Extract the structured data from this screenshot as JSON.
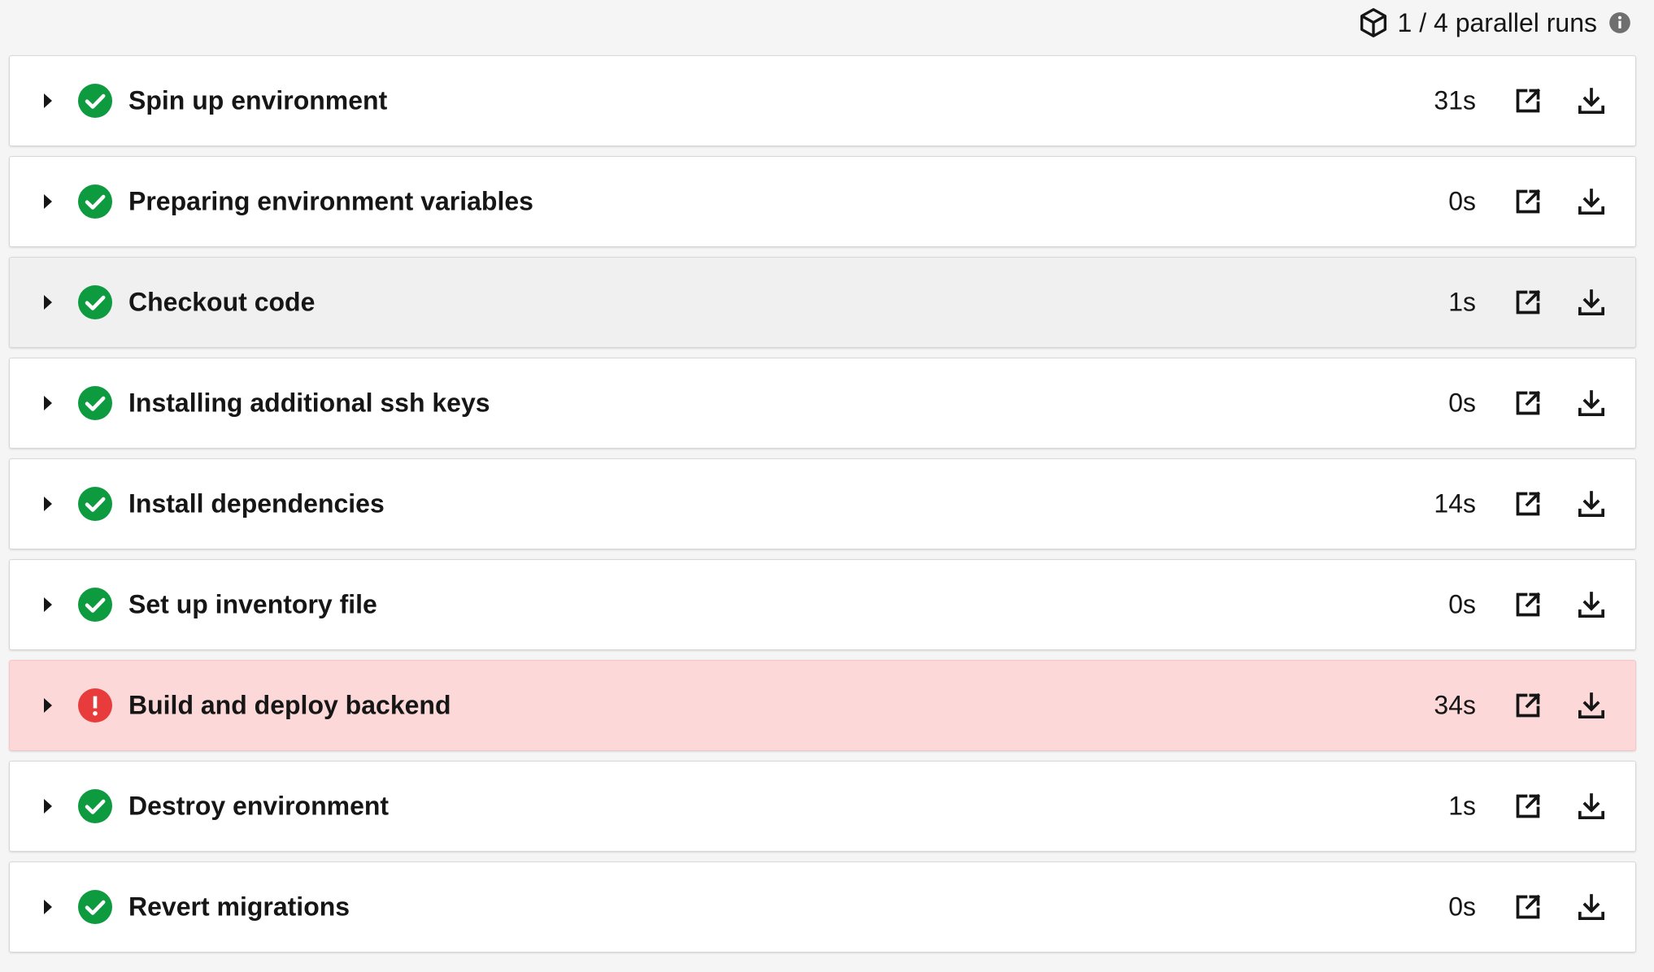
{
  "header": {
    "parallel_runs": "1 / 4 parallel runs"
  },
  "colors": {
    "success": "#0e9b3f",
    "failed": "#e83c3c",
    "failed_row_bg": "#fcd8d8",
    "hover_row_bg": "#f0f0f0"
  },
  "steps": [
    {
      "name": "Spin up environment",
      "duration": "31s",
      "status": "success"
    },
    {
      "name": "Preparing environment variables",
      "duration": "0s",
      "status": "success"
    },
    {
      "name": "Checkout code",
      "duration": "1s",
      "status": "success",
      "hovered": true
    },
    {
      "name": "Installing additional ssh keys",
      "duration": "0s",
      "status": "success"
    },
    {
      "name": "Install dependencies",
      "duration": "14s",
      "status": "success"
    },
    {
      "name": "Set up inventory file",
      "duration": "0s",
      "status": "success"
    },
    {
      "name": "Build and deploy backend",
      "duration": "34s",
      "status": "failed"
    },
    {
      "name": "Destroy environment",
      "duration": "1s",
      "status": "success"
    },
    {
      "name": "Revert migrations",
      "duration": "0s",
      "status": "success"
    }
  ],
  "icons": {
    "parallel": "cube-icon",
    "info": "info-icon",
    "expand": "caret-right-icon",
    "success": "check-circle-icon",
    "failed": "error-circle-icon",
    "open": "external-link-icon",
    "download": "download-icon"
  }
}
